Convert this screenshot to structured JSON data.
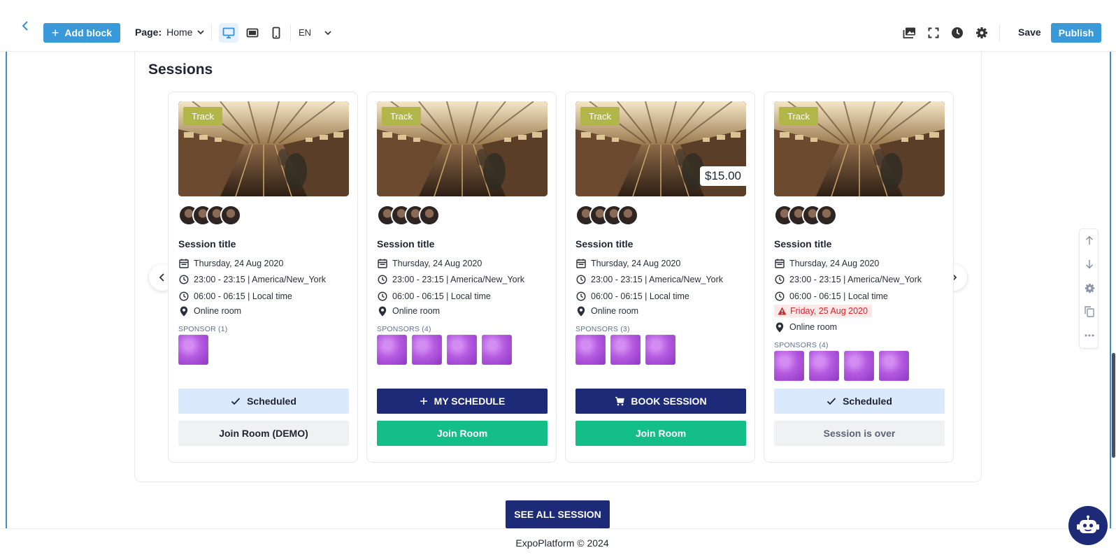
{
  "toolbar": {
    "add_block_label": "Add block",
    "page_label": "Page:",
    "page_value": "Home",
    "language": "EN",
    "save_label": "Save",
    "publish_label": "Publish",
    "active_device": "desktop"
  },
  "section": {
    "title": "Sessions",
    "see_all_label": "SEE ALL SESSION"
  },
  "cards": [
    {
      "badge": "Track",
      "price": "",
      "title": "Session title",
      "date": "Thursday, 24 Aug 2020",
      "time_tz": "23:00 - 23:15 | America/New_York",
      "time_local": "06:00 - 06:15 | Local time",
      "warning": "",
      "room": "Online room",
      "sponsors_label": "SPONSOR (1)",
      "sponsor_count": 1,
      "primary_button": "Scheduled",
      "secondary_button": "Join Room (DEMO)"
    },
    {
      "badge": "Track",
      "price": "",
      "title": "Session title",
      "date": "Thursday, 24 Aug 2020",
      "time_tz": "23:00 - 23:15 | America/New_York",
      "time_local": "06:00 - 06:15 | Local time",
      "warning": "",
      "room": "Online room",
      "sponsors_label": "SPONSORS (4)",
      "sponsor_count": 4,
      "primary_button": "MY SCHEDULE",
      "secondary_button": "Join Room"
    },
    {
      "badge": "Track",
      "price": "$15.00",
      "title": "Session title",
      "date": "Thursday, 24 Aug 2020",
      "time_tz": "23:00 - 23:15 | America/New_York",
      "time_local": "06:00 - 06:15 | Local time",
      "warning": "",
      "room": "Online room",
      "sponsors_label": "SPONSORS (3)",
      "sponsor_count": 3,
      "primary_button": "BOOK SESSION",
      "secondary_button": "Join Room"
    },
    {
      "badge": "Track",
      "price": "",
      "title": "Session title",
      "date": "Thursday, 24 Aug 2020",
      "time_tz": "23:00 - 23:15 | America/New_York",
      "time_local": "06:00 - 06:15 | Local time",
      "warning": "Friday, 25 Aug 2020",
      "room": "Online room",
      "sponsors_label": "SPONSORS (4)",
      "sponsor_count": 4,
      "primary_button": "Scheduled",
      "secondary_button": "Session is over"
    }
  ],
  "footer": {
    "text": "ExpoPlatform © 2024"
  },
  "colors": {
    "accent": "#3a9ad9",
    "navy": "#1c2a78",
    "green": "#13bf87",
    "track_badge": "#b2b54a",
    "warning": "#d3262b"
  },
  "icons": [
    "back-chevron-icon",
    "plus-icon",
    "chevron-down-icon",
    "desktop-icon",
    "tablet-icon",
    "mobile-icon",
    "media-icon",
    "fullscreen-icon",
    "history-icon",
    "gear-icon",
    "calendar-icon",
    "clock-icon",
    "location-pin-icon",
    "alert-icon",
    "check-icon",
    "cart-icon",
    "arrow-up-icon",
    "arrow-down-icon",
    "copy-icon",
    "more-icon",
    "chatbot-icon"
  ]
}
